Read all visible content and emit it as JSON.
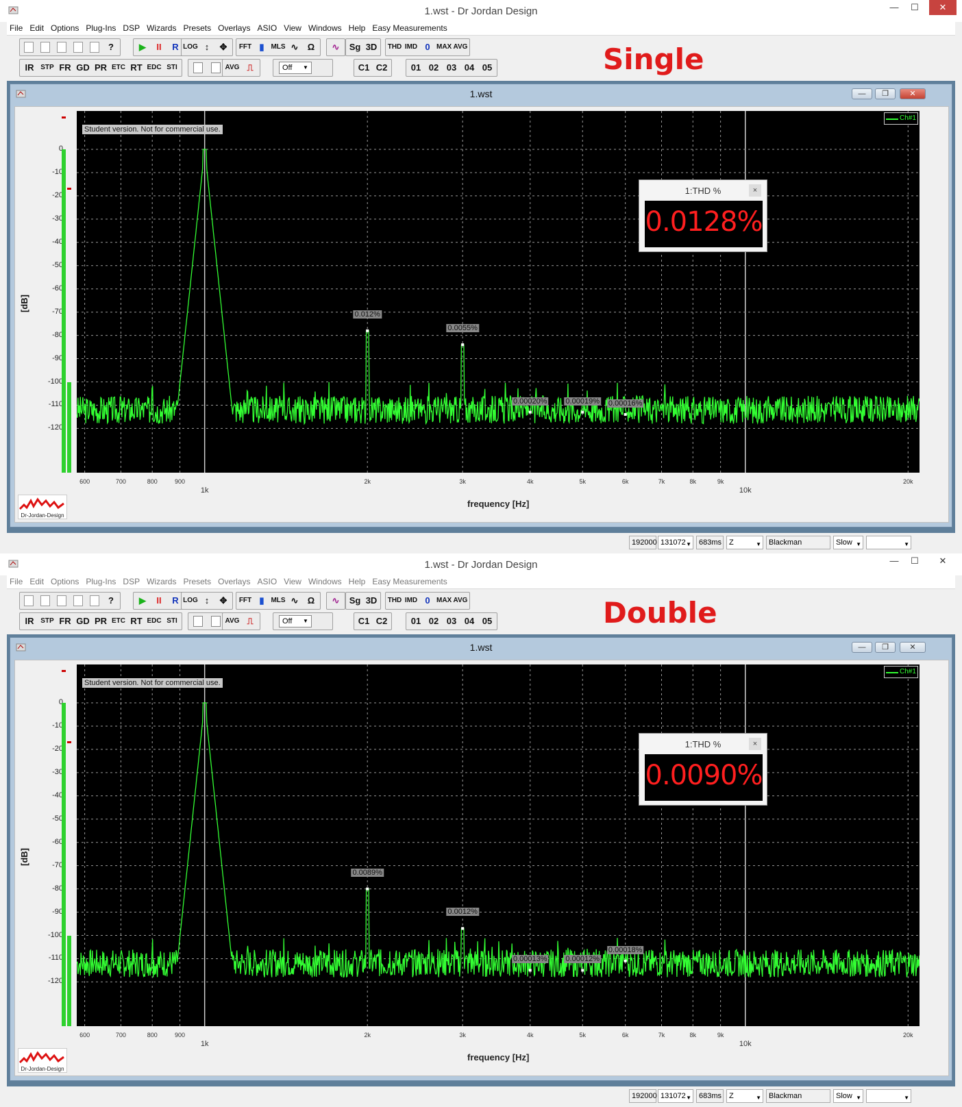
{
  "windows": [
    {
      "id": "single",
      "title": "1.wst - Dr Jordan Design",
      "menu_active": true,
      "tag": "Single",
      "child_title": "1.wst",
      "thd_title": "1:THD %",
      "thd_value": "0.0128%",
      "harmonic_labels": [
        {
          "f": 2000,
          "db": -78,
          "text": "0.012%"
        },
        {
          "f": 3000,
          "db": -84,
          "text": "0.0055%"
        },
        {
          "f": 4000,
          "db": -113,
          "text": "0.00020%"
        },
        {
          "f": 5000,
          "db": -113,
          "text": "0.00019%"
        },
        {
          "f": 6000,
          "db": -114,
          "text": "0.00016%"
        }
      ]
    },
    {
      "id": "double",
      "title": "1.wst - Dr Jordan Design",
      "menu_active": false,
      "tag": "Double",
      "child_title": "1.wst",
      "thd_title": "1:THD %",
      "thd_value": "0.0090%",
      "harmonic_labels": [
        {
          "f": 2000,
          "db": -80,
          "text": "0.0089%"
        },
        {
          "f": 3000,
          "db": -97,
          "text": "0.0012%"
        },
        {
          "f": 4000,
          "db": -115,
          "text": "0.00013%"
        },
        {
          "f": 5000,
          "db": -115,
          "text": "0.00012%"
        },
        {
          "f": 6000,
          "db": -111,
          "text": "0.00018%"
        }
      ]
    }
  ],
  "menu": [
    "File",
    "Edit",
    "Options",
    "Plug-Ins",
    "DSP",
    "Wizards",
    "Presets",
    "Overlays",
    "ASIO",
    "View",
    "Windows",
    "Help",
    "Easy Measurements"
  ],
  "toolbar1": [
    "",
    "",
    "",
    "",
    "",
    "?",
    "▶",
    "II",
    "R",
    "LOG",
    "↕",
    "✥",
    "FFT",
    "▮",
    "MLS",
    "∿",
    "Ω",
    "∿",
    "Sg",
    "3D",
    "THD",
    "IMD",
    "0",
    "MAX",
    "AVG"
  ],
  "toolbar2": [
    "IR",
    "STP",
    "FR",
    "GD",
    "PR",
    "ETC",
    "RT",
    "EDC",
    "STI",
    "",
    "",
    "AVG",
    "⎍",
    "C1",
    "C2",
    "01",
    "02",
    "03",
    "04",
    "05"
  ],
  "toolbar2_select": "Off",
  "plot": {
    "student_text": "Student version. Not for commercial use.",
    "legend": "Ch#1",
    "ylabel": "[dB]",
    "xlabel": "frequency [Hz]",
    "yticks": [
      "0",
      "-10",
      "-20",
      "-30",
      "-40",
      "-50",
      "-60",
      "-70",
      "-80",
      "-90",
      "-100",
      "-110",
      "-120"
    ],
    "xticks_minor": [
      "600",
      "700",
      "800",
      "900",
      "2k",
      "3k",
      "4k",
      "5k",
      "6k",
      "7k",
      "8k",
      "9k",
      "20k"
    ],
    "xticks_major": [
      "1k",
      "10k"
    ],
    "logo_text": "Dr-Jordan-Design"
  },
  "chart_data": [
    {
      "type": "line",
      "title": "",
      "xlabel": "frequency [Hz]",
      "ylabel": "[dB]",
      "xscale": "log",
      "xlim": [
        580,
        21000
      ],
      "ylim": [
        -136,
        16
      ],
      "series": [
        {
          "name": "Ch#1",
          "peaks": [
            [
              1000,
              0
            ],
            [
              2000,
              -78
            ],
            [
              3000,
              -84
            ],
            [
              4000,
              -113
            ],
            [
              5000,
              -113
            ],
            [
              6000,
              -114
            ]
          ],
          "noise_floor": -112
        }
      ]
    },
    {
      "type": "line",
      "title": "",
      "xlabel": "frequency [Hz]",
      "ylabel": "[dB]",
      "xscale": "log",
      "xlim": [
        580,
        21000
      ],
      "ylim": [
        -136,
        16
      ],
      "series": [
        {
          "name": "Ch#1",
          "peaks": [
            [
              1000,
              0
            ],
            [
              2000,
              -80
            ],
            [
              3000,
              -97
            ],
            [
              4000,
              -115
            ],
            [
              5000,
              -115
            ],
            [
              6000,
              -111
            ]
          ],
          "noise_floor": -112
        }
      ]
    }
  ],
  "status": {
    "rate": "192000",
    "fft": "131072",
    "ms": "683ms",
    "z": "Z",
    "window": "Blackman",
    "speed": "Slow"
  }
}
